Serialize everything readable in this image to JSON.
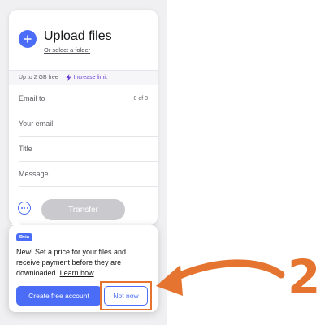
{
  "upload": {
    "title": "Upload files",
    "folder_link": "Or select a folder",
    "plus_icon": "plus-icon"
  },
  "limit": {
    "free_text": "Up to 2 GB free",
    "increase_label": "Increase limit",
    "icon": "lightning-bolt-icon"
  },
  "form": {
    "email_to_label": "Email to",
    "email_to_count": "0 of 3",
    "your_email_placeholder": "Your email",
    "title_placeholder": "Title",
    "message_placeholder": "Message"
  },
  "actions": {
    "options_icon": "more-options-icon",
    "transfer_label": "Transfer"
  },
  "popover": {
    "badge": "Beta",
    "text": "New! Set a price for your files and receive payment before they are downloaded.",
    "learn_link": "Learn how",
    "create_label": "Create free account",
    "not_now_label": "Not now"
  },
  "annotation": {
    "step_number": "2",
    "color": "#e4742f"
  },
  "colors": {
    "accent": "#4a6cf7",
    "purple_link": "#6b3fd6",
    "disabled_button": "#c9c9ce"
  }
}
